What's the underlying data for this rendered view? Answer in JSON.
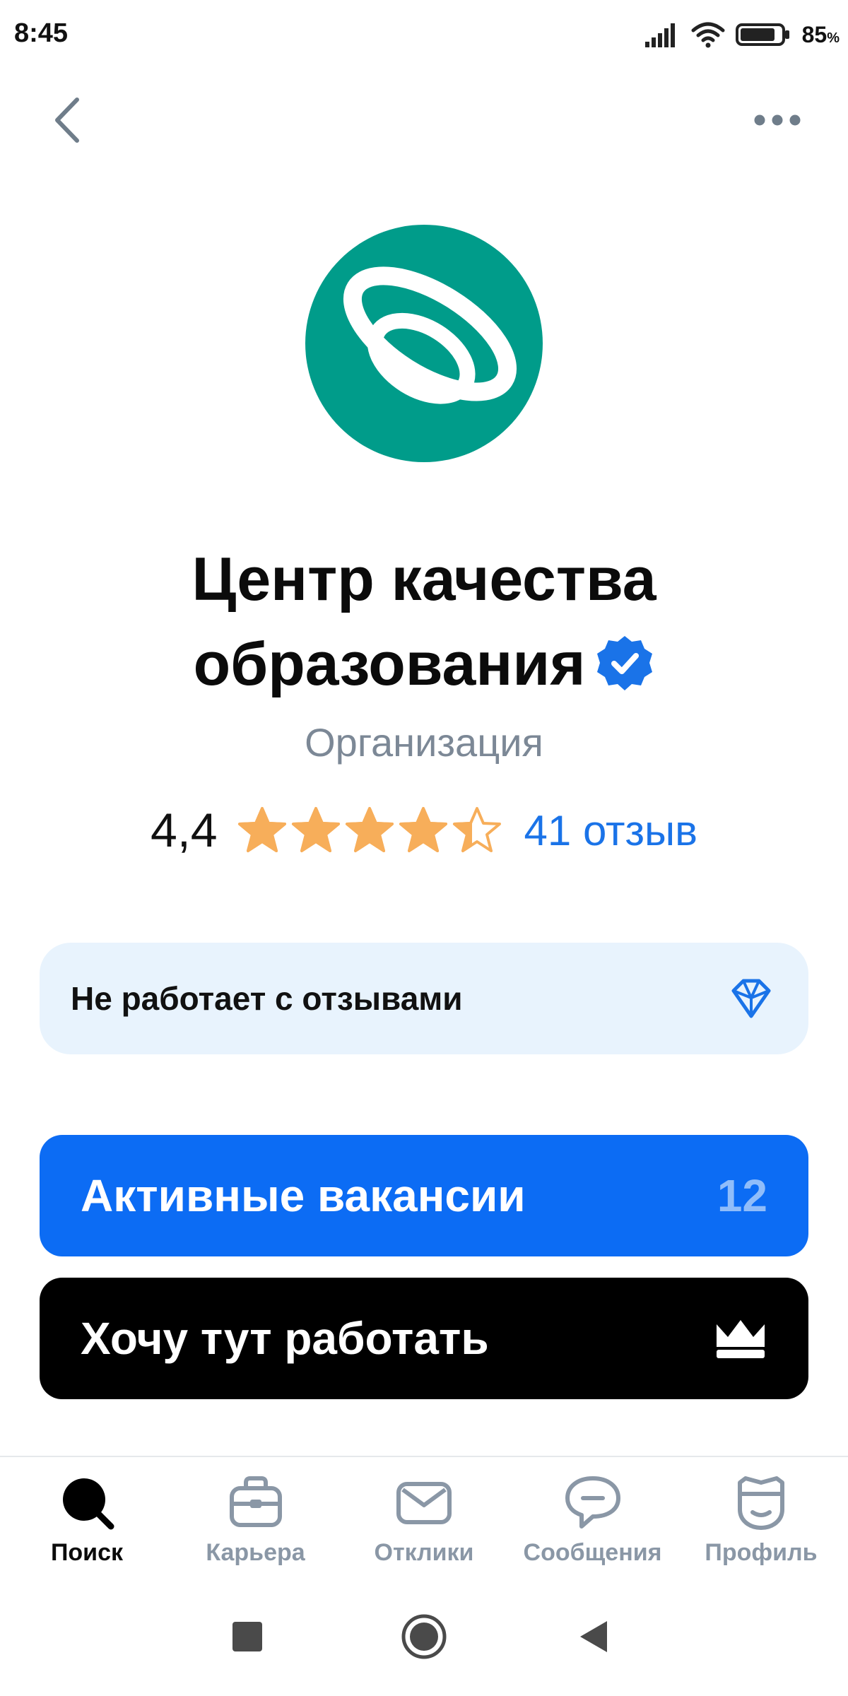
{
  "status_bar": {
    "time": "8:45",
    "battery_percent": "85",
    "battery_unit": "%",
    "battery_level": 0.85
  },
  "header": {
    "back_icon": "chevron-left-icon",
    "more_icon": "more-horizontal-icon"
  },
  "company": {
    "title_line1": "Центр качества",
    "title_line2": "образования",
    "type": "Организация",
    "logo_color": "#009c8a",
    "verified_color": "#1a73e8"
  },
  "rating": {
    "value": "4,4",
    "stars": 4.4,
    "star_color": "#f7ae5a",
    "reviews": "41 отзыв",
    "reviews_color": "#1a73e8"
  },
  "info_card": {
    "text": "Не работает с отзывами",
    "icon": "diamond-icon",
    "background": "#e8f3fd"
  },
  "actions": {
    "vacancies_label": "Активные вакансии",
    "vacancies_count": "12",
    "vacancies_color": "#0c6cf4",
    "want_work_label": "Хочу тут работать",
    "want_work_icon": "crown-icon"
  },
  "bottom_nav": {
    "items": [
      {
        "label": "Поиск",
        "icon": "search-icon",
        "active": true
      },
      {
        "label": "Карьера",
        "icon": "briefcase-icon",
        "active": false
      },
      {
        "label": "Отклики",
        "icon": "envelope-icon",
        "active": false
      },
      {
        "label": "Сообщения",
        "icon": "chat-bubble-icon",
        "active": false
      },
      {
        "label": "Профиль",
        "icon": "profile-face-icon",
        "active": false
      }
    ]
  },
  "system_nav": {
    "recent_icon": "square-icon",
    "home_icon": "circle-home-icon",
    "back_icon": "triangle-back-icon"
  }
}
